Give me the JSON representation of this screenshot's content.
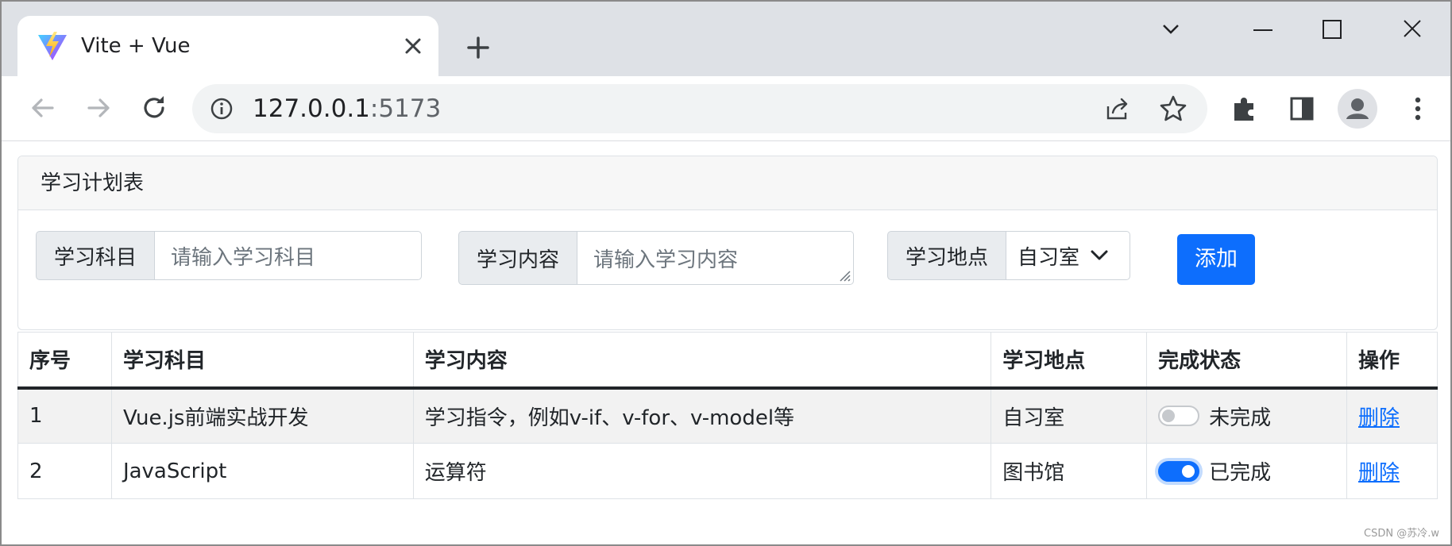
{
  "browser": {
    "tab_title": "Vite + Vue",
    "url_host": "127.0.0.1",
    "url_port": ":5173",
    "icons": [
      "vite-logo-icon",
      "close-icon",
      "plus-icon",
      "chevron-down-icon",
      "minimize-icon",
      "maximize-icon",
      "close-icon",
      "back-arrow-icon",
      "forward-arrow-icon",
      "reload-icon",
      "info-icon",
      "share-icon",
      "star-icon",
      "extensions-icon",
      "side-panel-icon",
      "profile-icon",
      "kebab-menu-icon"
    ]
  },
  "card": {
    "title": "学习计划表",
    "subject_label": "学习科目",
    "subject_placeholder": "请输入学习科目",
    "content_label": "学习内容",
    "content_placeholder": "请输入学习内容",
    "place_label": "学习地点",
    "place_selected": "自习室",
    "add_button": "添加"
  },
  "table": {
    "headers": [
      "序号",
      "学习科目",
      "学习内容",
      "学习地点",
      "完成状态",
      "操作"
    ],
    "rows": [
      {
        "index": "1",
        "subject": "Vue.js前端实战开发",
        "content": "学习指令，例如v-if、v-for、v-model等",
        "place": "自习室",
        "done": false,
        "status": "未完成",
        "action": "删除"
      },
      {
        "index": "2",
        "subject": "JavaScript",
        "content": "运算符",
        "place": "图书馆",
        "done": true,
        "status": "已完成",
        "action": "删除"
      }
    ]
  },
  "colors": {
    "primary": "#0d6efd",
    "tabstrip": "#dee1e6",
    "label_bg": "#e9ecef"
  },
  "watermark": "CSDN @苏冷.w"
}
